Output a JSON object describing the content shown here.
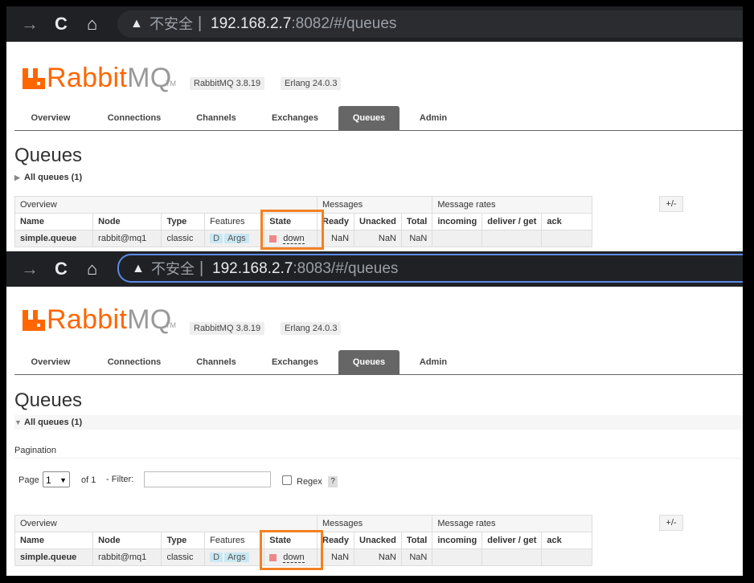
{
  "browser": {
    "insecure_label": "不安全",
    "separator": "|",
    "windows": [
      {
        "host": "192.168.2.7",
        "rest": ":8082/#/queues"
      },
      {
        "host": "192.168.2.7",
        "rest": ":8083/#/queues"
      }
    ]
  },
  "app": {
    "logo_rabbit": "Rabbit",
    "logo_mq": "MQ",
    "tm": "TM",
    "version": "RabbitMQ 3.8.19",
    "erlang": "Erlang 24.0.3",
    "brand_color": "#ff6600"
  },
  "tabs": [
    "Overview",
    "Connections",
    "Channels",
    "Exchanges",
    "Queues",
    "Admin"
  ],
  "active_tab": "Queues",
  "page_title": "Queues",
  "section_label": "All queues (1)",
  "pagination": {
    "title": "Pagination",
    "page_label": "Page",
    "page_value": "1",
    "of_label": "of 1",
    "filter_label": "- Filter:",
    "regex_label": "Regex",
    "help": "?"
  },
  "table": {
    "groups": [
      "Overview",
      "Messages",
      "Message rates"
    ],
    "plus_minus": "+/-",
    "headers": [
      "Name",
      "Node",
      "Type",
      "Features",
      "State",
      "Ready",
      "Unacked",
      "Total",
      "incoming",
      "deliver / get",
      "ack"
    ],
    "row": {
      "name": "simple.queue",
      "node": "rabbit@mq1",
      "type": "classic",
      "feature_d": "D",
      "feature_args": "Args",
      "state": "down",
      "ready": "NaN",
      "unacked": "NaN",
      "total": "NaN"
    }
  },
  "highlight_color": "#f28123"
}
